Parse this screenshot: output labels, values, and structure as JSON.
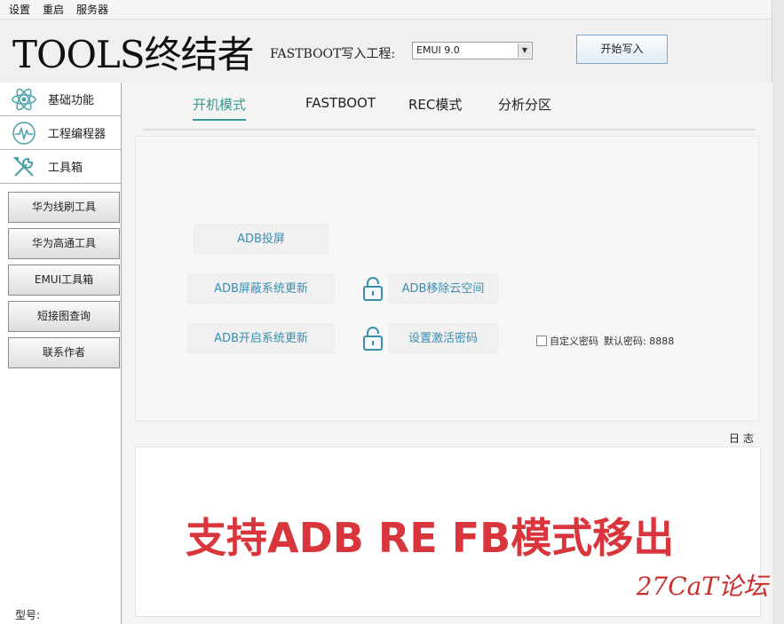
{
  "menubar": {
    "items": [
      "设置",
      "重启",
      "服务器"
    ]
  },
  "header": {
    "logo": "TOOLS终结者",
    "fastboot_label": "FASTBOOT写入工程:",
    "project_select_value": "EMUI 9.0",
    "start_button": "开始写入"
  },
  "sidebar": {
    "nav": [
      {
        "label": "基础功能",
        "icon": "react-atom-icon"
      },
      {
        "label": "工程编程器",
        "icon": "waveform-icon"
      },
      {
        "label": "工具箱",
        "icon": "tools-icon"
      }
    ],
    "tools": [
      "华为线刷工具",
      "华为高通工具",
      "EMUI工具箱",
      "短接图查询",
      "联系作者"
    ],
    "model_label": "型号:"
  },
  "tabs": [
    "开机模式",
    "FASTBOOT",
    "REC模式",
    "分析分区"
  ],
  "active_tab": "开机模式",
  "actions": {
    "adb_cast": "ADB投屏",
    "adb_block_update": "ADB屏蔽系统更新",
    "adb_remove_cloud": "ADB移除云空间",
    "adb_enable_update": "ADB开启系统更新",
    "set_activation_pwd": "设置激活密码",
    "custom_password_label": "自定义密码",
    "default_password": "默认密码: 8888"
  },
  "log": {
    "title": "日志",
    "banner": "支持ADB RE FB模式移出"
  },
  "watermark": "27CaT论坛",
  "colors": {
    "accent_teal": "#3a9b93",
    "action_text": "#3a8fb0",
    "banner_red": "#d9353c"
  }
}
